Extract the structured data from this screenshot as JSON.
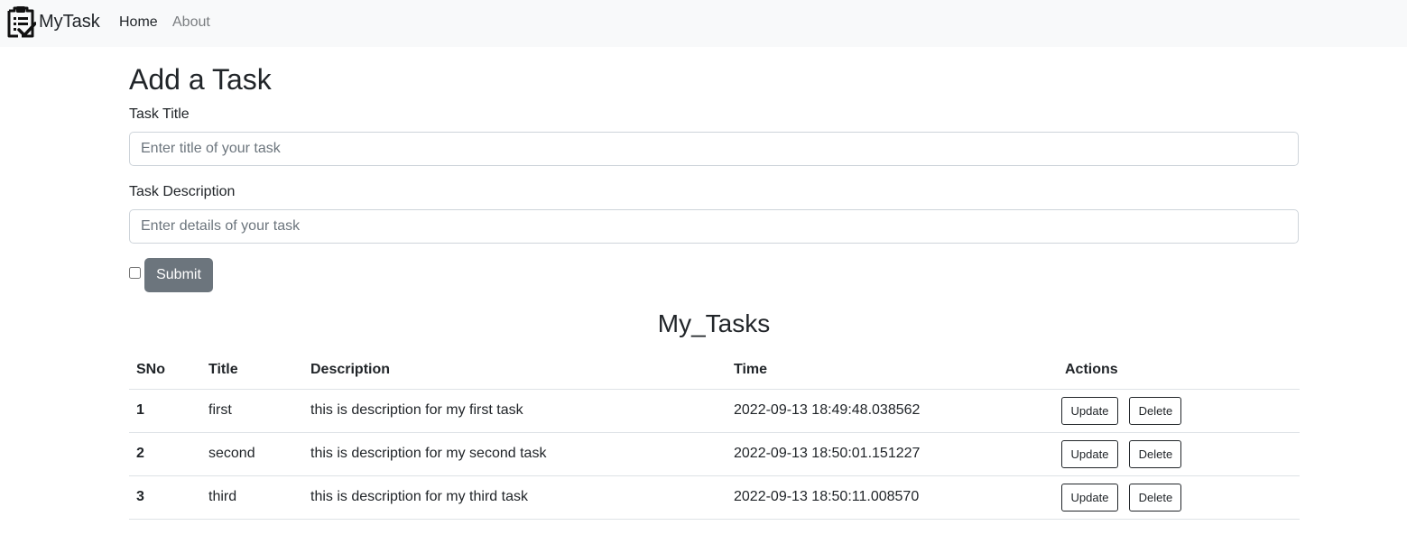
{
  "navbar": {
    "brand": "MyTask",
    "brand_icon": "clipboard-check-icon",
    "links": [
      {
        "label": "Home",
        "active": true
      },
      {
        "label": "About",
        "active": false
      }
    ]
  },
  "form": {
    "heading": "Add a Task",
    "title_label": "Task Title",
    "title_placeholder": "Enter title of your task",
    "title_value": "",
    "desc_label": "Task Description",
    "desc_placeholder": "Enter details of your task",
    "desc_value": "",
    "checkbox_checked": false,
    "submit_label": "Submit"
  },
  "tasks": {
    "heading": "My_Tasks",
    "columns": [
      "SNo",
      "Title",
      "Description",
      "Time",
      "Actions"
    ],
    "rows": [
      {
        "sno": "1",
        "title": "first",
        "description": "this is description for my first task",
        "time": "2022-09-13 18:49:48.038562"
      },
      {
        "sno": "2",
        "title": "second",
        "description": "this is description for my second task",
        "time": "2022-09-13 18:50:01.151227"
      },
      {
        "sno": "3",
        "title": "third",
        "description": "this is description for my third task",
        "time": "2022-09-13 18:50:11.008570"
      }
    ],
    "update_label": "Update",
    "delete_label": "Delete"
  },
  "colors": {
    "navbar_bg": "#f8f9fa",
    "submit_bg": "#6c757d",
    "text": "#212529",
    "muted_link": "#7a7d80",
    "border": "#dee2e6"
  }
}
